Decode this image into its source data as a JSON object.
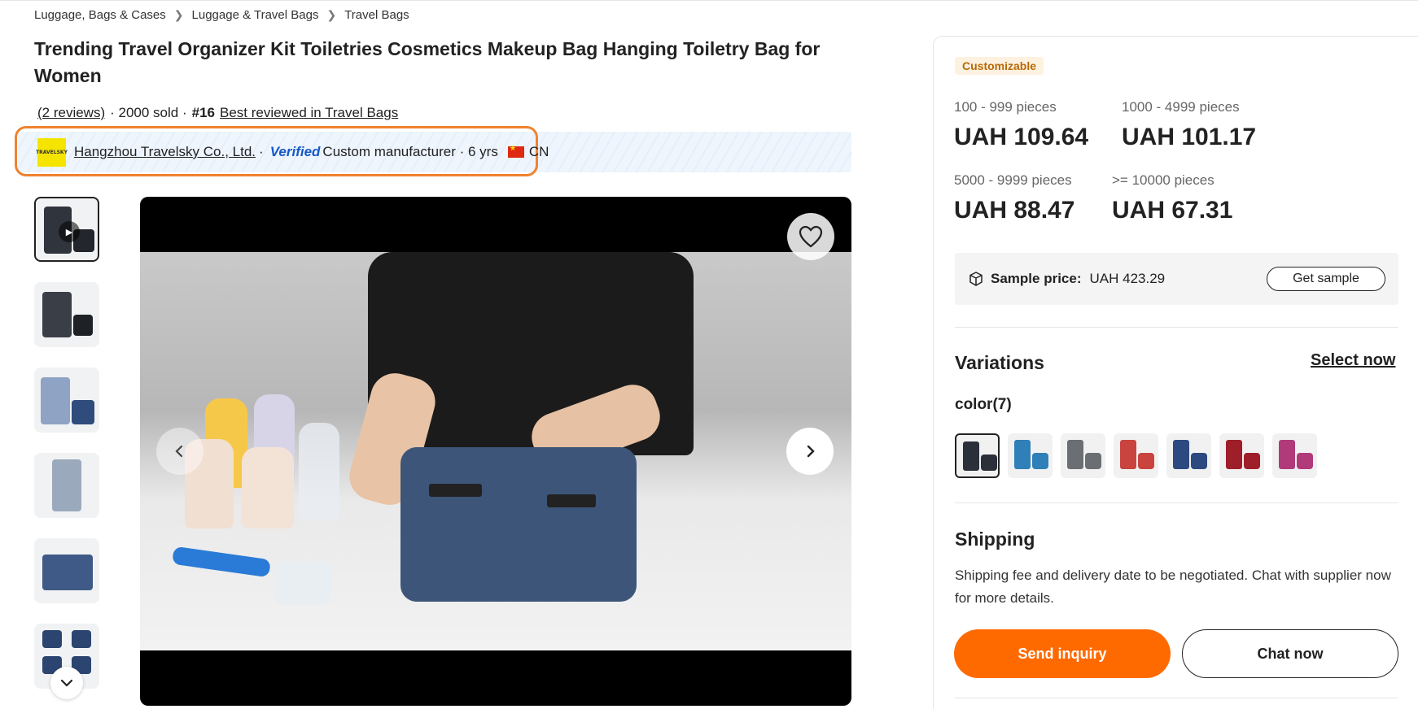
{
  "breadcrumb": [
    "Luggage, Bags & Cases",
    "Luggage & Travel Bags",
    "Travel Bags"
  ],
  "product": {
    "title": "Trending Travel Organizer Kit Toiletries Cosmetics Makeup Bag Hanging Toiletry Bag for Women",
    "reviews": "(2 reviews)",
    "sold": "· 2000 sold ·",
    "rank": "#16",
    "rank_link": "Best reviewed in Travel Bags"
  },
  "supplier": {
    "logo_text": "TRAVELSKY",
    "name": "Hangzhou Travelsky Co., Ltd.",
    "dot": "·",
    "verified": "Verified",
    "type": "Custom manufacturer · 6 yrs",
    "country": "CN"
  },
  "pricing": {
    "badge": "Customizable",
    "tiers": [
      {
        "qty": "100 - 999 pieces",
        "price": "UAH 109.64"
      },
      {
        "qty": "1000 - 4999 pieces",
        "price": "UAH 101.17"
      },
      {
        "qty": "5000 - 9999 pieces",
        "price": "UAH 88.47"
      },
      {
        "qty": ">= 10000 pieces",
        "price": "UAH 67.31"
      }
    ],
    "sample_label": "Sample price:",
    "sample_value": "UAH 423.29",
    "get_sample": "Get sample"
  },
  "variations": {
    "heading": "Variations",
    "select_now": "Select now",
    "color_label": "color(7)",
    "colors": [
      "#2a2f3a",
      "#2f7fb8",
      "#6b6e73",
      "#c9443f",
      "#2d4a80",
      "#9e1f2a",
      "#b03a7a"
    ]
  },
  "shipping": {
    "heading": "Shipping",
    "text": "Shipping fee and delivery date to be negotiated. Chat with supplier now for more details."
  },
  "actions": {
    "send_inquiry": "Send inquiry",
    "chat_now": "Chat now"
  },
  "colors": {
    "accent": "#ff6a00",
    "highlight": "#f0822f",
    "verified": "#1758c7"
  }
}
